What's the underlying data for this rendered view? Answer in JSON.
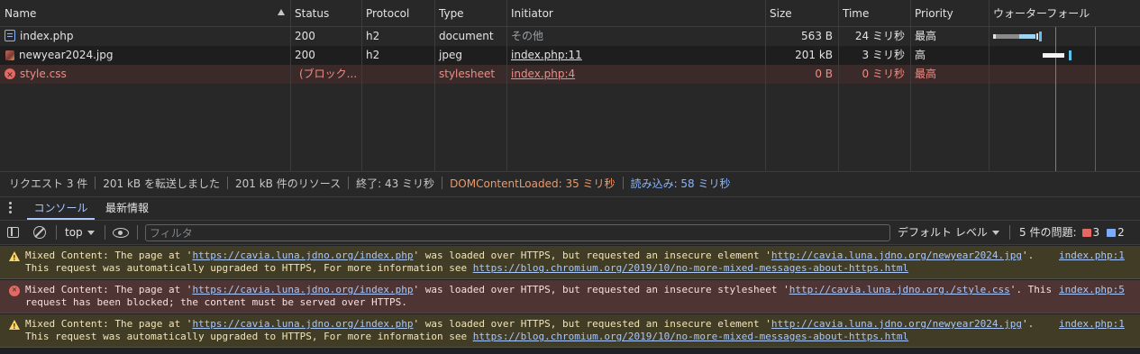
{
  "network": {
    "columns": {
      "name": "Name",
      "status": "Status",
      "protocol": "Protocol",
      "type": "Type",
      "initiator": "Initiator",
      "size": "Size",
      "time": "Time",
      "priority": "Priority",
      "waterfall": "ウォーターフォール"
    },
    "rows": [
      {
        "name": "index.php",
        "status": "200",
        "protocol": "h2",
        "type": "document",
        "initiator": "その他",
        "size": "563 B",
        "time": "24 ミリ秒",
        "priority": "最高",
        "icon": "document-icon"
      },
      {
        "name": "newyear2024.jpg",
        "status": "200",
        "protocol": "h2",
        "type": "jpeg",
        "initiator": "index.php:11",
        "size": "201 kB",
        "time": "3 ミリ秒",
        "priority": "高",
        "icon": "image-icon"
      },
      {
        "name": "style.css",
        "status": "(ブロック...",
        "protocol": "",
        "type": "stylesheet",
        "initiator": "index.php:4",
        "size": "0 B",
        "time": "0 ミリ秒",
        "priority": "最高",
        "icon": "error-icon"
      }
    ]
  },
  "summary": {
    "requests": "リクエスト 3 件",
    "transferred": "201 kB を転送しました",
    "resources": "201 kB 件のリソース",
    "finish": "終了: 43 ミリ秒",
    "dom_content_loaded": "DOMContentLoaded: 35 ミリ秒",
    "load": "読み込み: 58 ミリ秒"
  },
  "drawer": {
    "tabs": [
      "コンソール",
      "最新情報"
    ],
    "active_tab": "コンソール"
  },
  "console_toolbar": {
    "context": "top",
    "filter_placeholder": "フィルタ",
    "levels": "デフォルト レベル",
    "issues_label": "5 件の問題:",
    "issues_errors": "3",
    "issues_info": "2"
  },
  "messages": [
    {
      "level": "warning",
      "prefix": "Mixed Content: The page at '",
      "page_url": "https://cavia.luna.jdno.org/index.php",
      "middle": "' was loaded over HTTPS, but requested an insecure element '",
      "resource_url": "http://cavia.luna.jdno.org/newyear2024.jpg",
      "suffix": "'.",
      "line2_prefix": "This request was automatically upgraded to HTTPS, For more information see ",
      "line2_url": "https://blog.chromium.org/2019/10/no-more-mixed-messages-about-https.html",
      "line2_suffix": "",
      "source": "index.php:1"
    },
    {
      "level": "error",
      "prefix": "Mixed Content: The page at '",
      "page_url": "https://cavia.luna.jdno.org/index.php",
      "middle": "' was loaded over HTTPS, but requested an insecure stylesheet '",
      "resource_url": "http://cavia.luna.jdno.org./style.css",
      "suffix": "'. This",
      "line2_prefix": "request has been blocked; the content must be served over HTTPS.",
      "line2_url": "",
      "line2_suffix": "",
      "source": "index.php:5"
    },
    {
      "level": "warning",
      "prefix": "Mixed Content: The page at '",
      "page_url": "https://cavia.luna.jdno.org/index.php",
      "middle": "' was loaded over HTTPS, but requested an insecure element '",
      "resource_url": "http://cavia.luna.jdno.org/newyear2024.jpg",
      "suffix": "'.",
      "line2_prefix": "This request was automatically upgraded to HTTPS, For more information see ",
      "line2_url": "https://blog.chromium.org/2019/10/no-more-mixed-messages-about-https.html",
      "line2_suffix": "",
      "source": "index.php:1"
    }
  ],
  "colors": {
    "background": "#202124",
    "panel": "#282828",
    "error_text": "#f28b82",
    "dcl": "#f29766",
    "load": "#8ab4f8",
    "warning_bg": "#413c26",
    "error_bg": "#4e3534"
  }
}
